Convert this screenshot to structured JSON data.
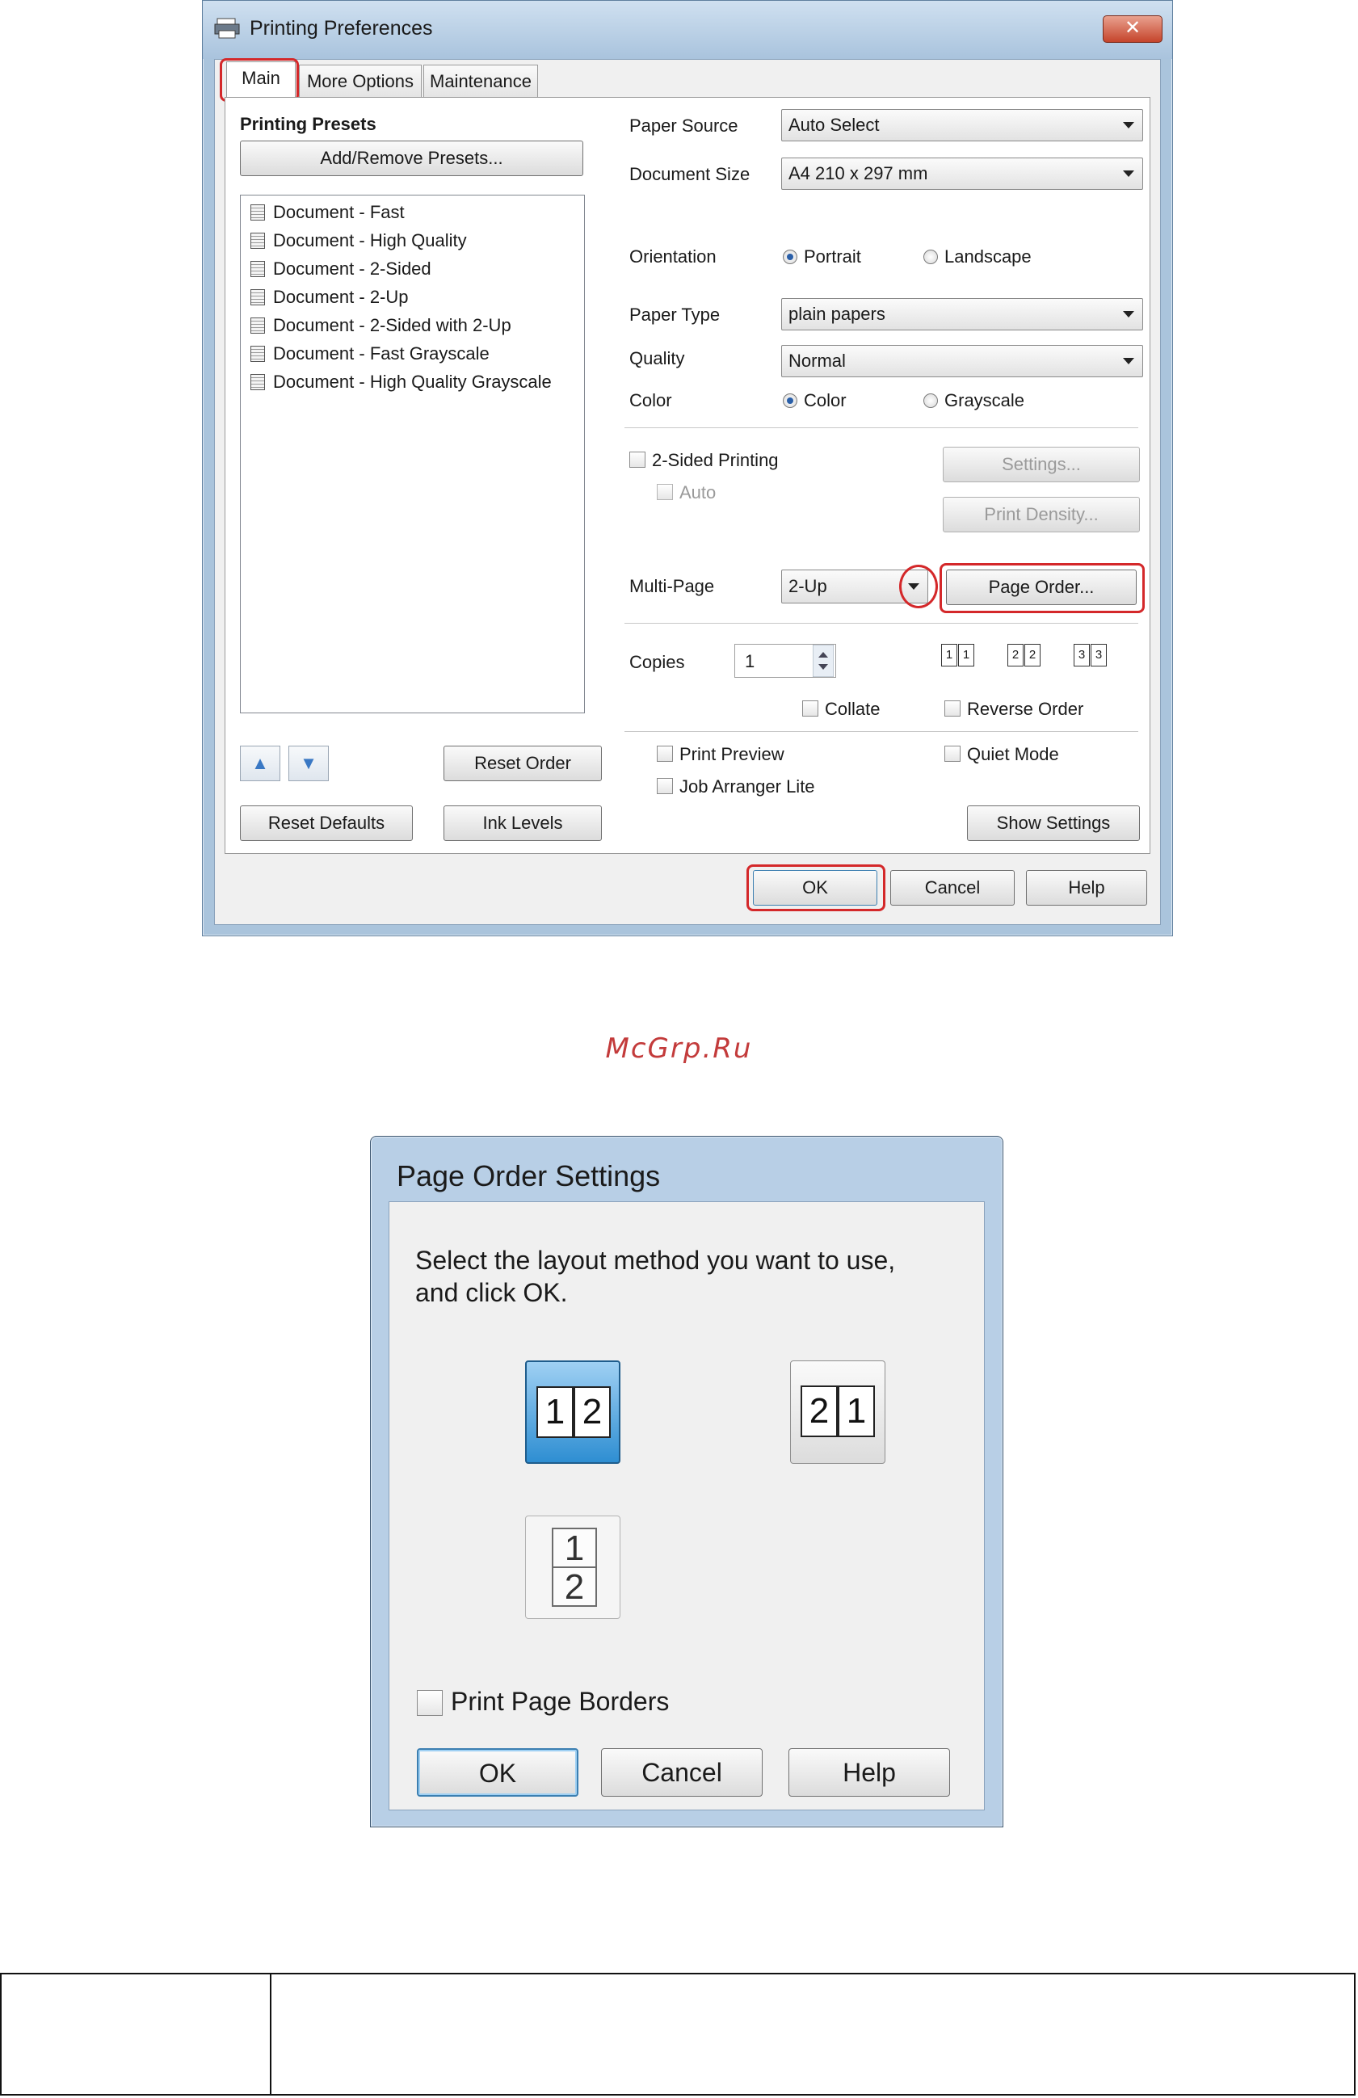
{
  "prefs": {
    "title": "Printing Preferences",
    "close_label": "✕",
    "tabs": [
      "Main",
      "More Options",
      "Maintenance"
    ],
    "presets_heading": "Printing Presets",
    "add_remove_presets": "Add/Remove Presets...",
    "presets": [
      "Document - Fast",
      "Document - High Quality",
      "Document - 2-Sided",
      "Document - 2-Up",
      "Document - 2-Sided with 2-Up",
      "Document - Fast Grayscale",
      "Document - High Quality Grayscale"
    ],
    "reset_order": "Reset Order",
    "reset_defaults": "Reset Defaults",
    "ink_levels": "Ink Levels",
    "up_arrow": "▲",
    "down_arrow": "▼",
    "paper_source_label": "Paper Source",
    "paper_source_value": "Auto Select",
    "document_size_label": "Document Size",
    "document_size_value": "A4 210 x 297 mm",
    "orientation_label": "Orientation",
    "portrait": "Portrait",
    "landscape": "Landscape",
    "paper_type_label": "Paper Type",
    "paper_type_value": "plain papers",
    "quality_label": "Quality",
    "quality_value": "Normal",
    "color_label": "Color",
    "color_option": "Color",
    "grayscale_option": "Grayscale",
    "two_sided": "2-Sided Printing",
    "auto": "Auto",
    "settings": "Settings...",
    "print_density": "Print Density...",
    "multi_page_label": "Multi-Page",
    "multi_page_value": "2-Up",
    "page_order": "Page Order...",
    "copies_label": "Copies",
    "copies_value": "1",
    "collate": "Collate",
    "reverse_order": "Reverse Order",
    "print_preview": "Print Preview",
    "quiet_mode": "Quiet Mode",
    "job_arranger": "Job Arranger Lite",
    "show_settings": "Show Settings",
    "ok": "OK",
    "cancel": "Cancel",
    "help": "Help",
    "order_icons": [
      [
        "1",
        "1"
      ],
      [
        "2",
        "2"
      ],
      [
        "3",
        "3"
      ]
    ]
  },
  "watermark": "McGrp.Ru",
  "page_order_dialog": {
    "title": "Page Order Settings",
    "prompt": "Select the layout method you want to use,\nand click OK.",
    "options": [
      {
        "pages": [
          "1",
          "2"
        ],
        "selected": true
      },
      {
        "pages": [
          "2",
          "1"
        ],
        "selected": false
      },
      {
        "pages": [
          "1",
          "2"
        ],
        "selected": false
      }
    ],
    "print_page_borders": "Print Page Borders",
    "ok": "OK",
    "cancel": "Cancel",
    "help": "Help"
  },
  "colors": {
    "highlight_red": "#d4282a",
    "selected_blue": "#2e8ed2",
    "watermark_red": "#c33b3b"
  }
}
